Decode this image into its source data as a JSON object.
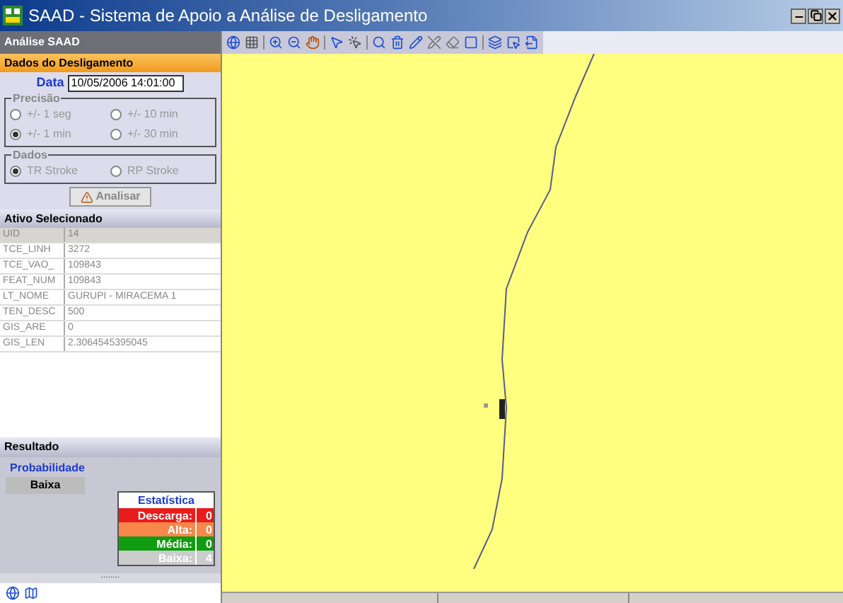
{
  "window": {
    "title": "SAAD - Sistema de Apoio a Análise de Desligamento"
  },
  "panel": {
    "title": "Análise SAAD"
  },
  "dados_desligamento": {
    "title": "Dados do Desligamento",
    "data_label": "Data",
    "data_value": "10/05/2006 14:01:00",
    "precisao": {
      "title": "Precisão",
      "options": [
        {
          "label": "+/- 1 seg",
          "selected": false
        },
        {
          "label": "+/- 10 min",
          "selected": false
        },
        {
          "label": "+/- 1 min",
          "selected": true
        },
        {
          "label": "+/- 30 min",
          "selected": false
        }
      ]
    },
    "dados": {
      "title": "Dados",
      "options": [
        {
          "label": "TR Stroke",
          "selected": true
        },
        {
          "label": "RP Stroke",
          "selected": false
        }
      ]
    },
    "button": "Analisar"
  },
  "ativo": {
    "title": "Ativo Selecionado",
    "rows": [
      {
        "field": "UID",
        "value": "14",
        "header": true
      },
      {
        "field": "TCE_LINH",
        "value": "3272",
        "header": false
      },
      {
        "field": "TCE_VAO_",
        "value": "109843",
        "header": false
      },
      {
        "field": "FEAT_NUM",
        "value": "109843",
        "header": false
      },
      {
        "field": "LT_NOME",
        "value": "GURUPI - MIRACEMA 1",
        "header": false
      },
      {
        "field": "TEN_DESC",
        "value": "500",
        "header": false
      },
      {
        "field": "GIS_ARE",
        "value": "0",
        "header": false
      },
      {
        "field": "GIS_LEN",
        "value": "2.3064545395045",
        "header": false
      }
    ]
  },
  "resultado": {
    "title": "Resultado",
    "prob_label": "Probabilidade",
    "prob_value": "Baixa",
    "estatistica": {
      "title": "Estatística",
      "rows": [
        {
          "label": "Descarga:",
          "value": "0",
          "color": "#e81c1c"
        },
        {
          "label": "Alta:",
          "value": "0",
          "color": "#f7874a"
        },
        {
          "label": "Média:",
          "value": "0",
          "color": "#109c10"
        },
        {
          "label": "Baixa:",
          "value": "4",
          "color": "#cccccc"
        }
      ]
    }
  },
  "splitter": "........"
}
